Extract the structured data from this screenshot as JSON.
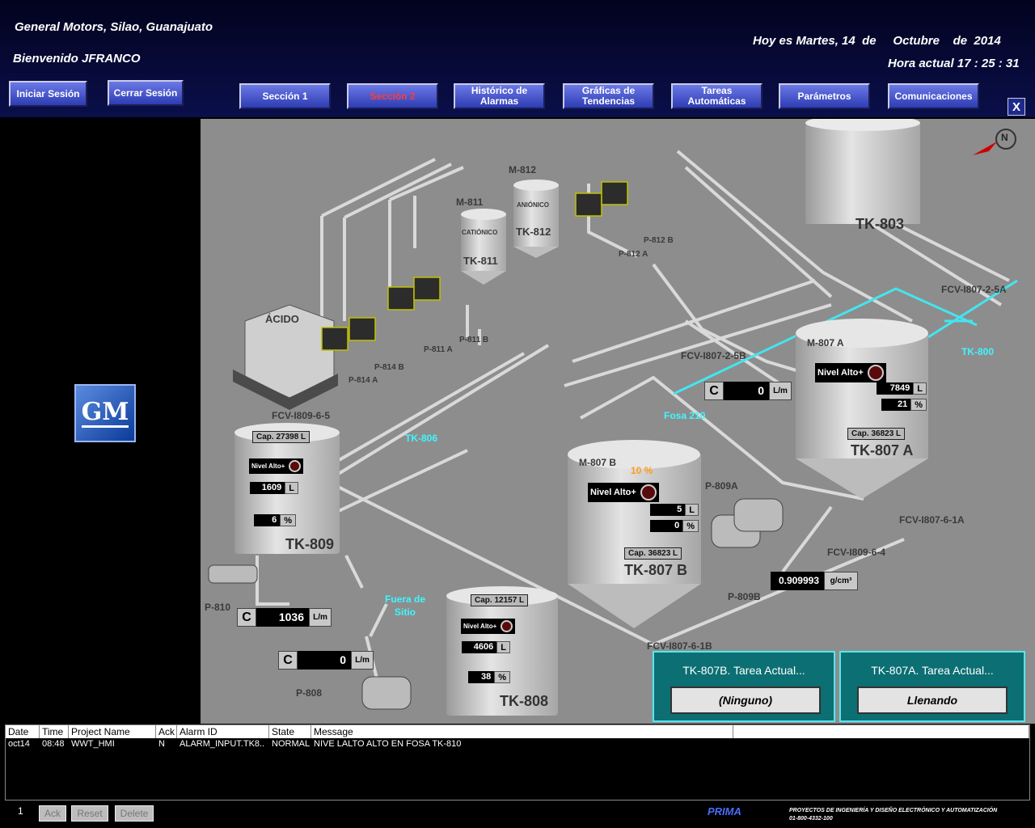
{
  "header": {
    "company": "General Motors, Silao, Guanajuato",
    "welcome": "Bienvenido JFRANCO",
    "date": "Hoy es Martes, 14  de     Octubre    de  2014",
    "time": "Hora actual 17 : 25 : 31"
  },
  "buttons": {
    "login": "Iniciar Sesión",
    "logout": "Cerrar Sesión",
    "section1": "Sección 1",
    "section2": "Sección 2",
    "alarms": "Histórico de Alarmas",
    "trends": "Gráficas de Tendencias",
    "tasks": "Tareas Automáticas",
    "params": "Parámetros",
    "comms": "Comunicaciones",
    "close": "X"
  },
  "logo": "GM",
  "compass": "N",
  "tanks": {
    "tk803": "TK-803",
    "tk811": "TK-811",
    "tk812": "TK-812",
    "tk809": "TK-809",
    "tk808": "TK-808",
    "tk807b": "TK-807 B",
    "tk807a": "TK-807 A",
    "acido": "ÁCIDO",
    "cationico": "CATIÓNICO",
    "anionico": "ANIÓNICO"
  },
  "labels": {
    "m812": "M-812",
    "m811": "M-811",
    "p812b": "P-812 B",
    "p812a": "P-812 A",
    "p811b": "P-811 B",
    "p811a": "P-811 A",
    "p814b": "P-814 B",
    "p814a": "P-814 A",
    "fcv80725a": "FCV-I807-2-5A",
    "fcv80725b": "FCV-I807-2-5B",
    "fcv80965": "FCV-I809-6-5",
    "m807a": "M-807 A",
    "m807b": "M-807 B",
    "m807b_pct": "10 %",
    "p809a": "P-809A",
    "p809b": "P-809B",
    "fcv80761a": "FCV-I807-6-1A",
    "fcv80964": "FCV-I809-6-4",
    "fcv80761b": "FCV-I807-6-1B",
    "p810": "P-810",
    "p808": "P-808",
    "tk800": "TK-800",
    "fosa210": "Fosa 210",
    "tk806": "TK-806",
    "fuera": "Fuera de Sitio"
  },
  "tk807a": {
    "nivel": "Nivel Alto+",
    "litros": "7849",
    "litros_u": "L",
    "pct": "21",
    "pct_u": "%",
    "cap": "Cap. 36823  L"
  },
  "tk807b": {
    "nivel": "Nivel Alto+",
    "litros": "5",
    "litros_u": "L",
    "pct": "0",
    "pct_u": "%",
    "cap": "Cap. 36823  L"
  },
  "tk809": {
    "nivel": "Nivel Alto+",
    "litros": "1609",
    "litros_u": "L",
    "pct": "6",
    "pct_u": "%",
    "cap": "Cap. 27398  L"
  },
  "tk808": {
    "nivel": "Nivel Alto+",
    "litros": "4606",
    "litros_u": "L",
    "pct": "38",
    "pct_u": "%",
    "cap": "Cap. 12157  L"
  },
  "flows": {
    "fosa": {
      "c": "C",
      "v": "0",
      "u": "L/m"
    },
    "p810": {
      "c": "C",
      "v": "1036",
      "u": "L/m"
    },
    "p808": {
      "c": "C",
      "v": "0",
      "u": "L/m"
    }
  },
  "density": {
    "v": "0.909993",
    "u": "g/cm³"
  },
  "tasks": {
    "b_title": "TK-807B. Tarea Actual...",
    "b_value": "(Ninguno)",
    "a_title": "TK-807A. Tarea Actual...",
    "a_value": "Llenando"
  },
  "alarms": {
    "headers": [
      "Date",
      "Time",
      "Project Name",
      "Ack",
      "Alarm ID",
      "State",
      "Message"
    ],
    "rows": [
      [
        "oct14",
        "08:48",
        "WWT_HMI",
        "N",
        "ALARM_INPUT.TK8..",
        "NORMAL",
        "NIVE LALTO ALTO EN FOSA TK-810"
      ]
    ]
  },
  "footer": {
    "count": "1",
    "ack": "Ack",
    "reset": "Reset",
    "delete": "Delete",
    "brand": "PRIMA",
    "brand_line1": "PROYECTOS DE INGENIERÍA Y DISEÑO ELECTRÓNICO Y AUTOMATIZACIÓN",
    "brand_line2": "01-800-4332-100"
  }
}
